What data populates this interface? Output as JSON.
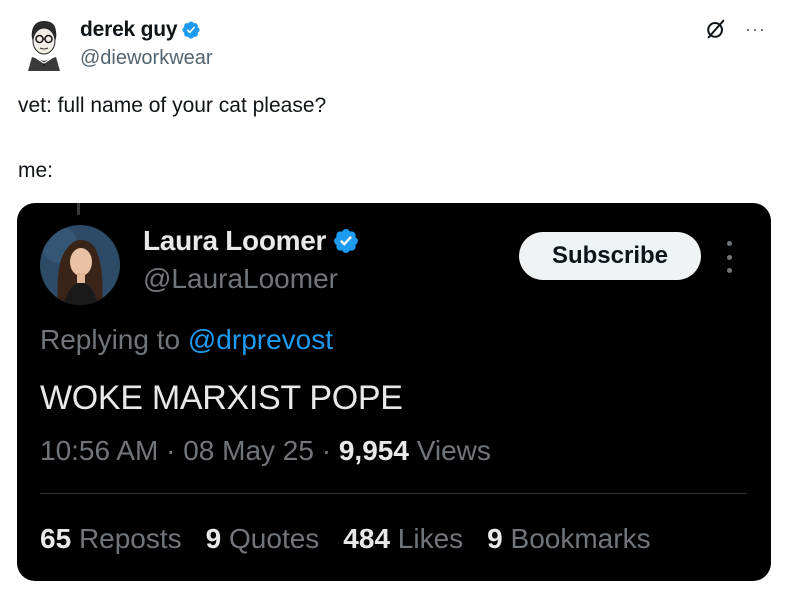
{
  "outer_tweet": {
    "display_name": "derek guy",
    "handle": "@dieworkwear",
    "text_line1": "vet: full name of your cat please?",
    "text_line2": "me:",
    "more_label": "···"
  },
  "embedded_tweet": {
    "display_name": "Laura Loomer",
    "handle": "@LauraLoomer",
    "subscribe_label": "Subscribe",
    "replying_prefix": "Replying to",
    "replying_handle": "@drprevost",
    "text": "WOKE MARXIST POPE",
    "time": "10:56 AM",
    "date": "08 May 25",
    "views_count": "9,954",
    "views_label": "Views",
    "stats": [
      {
        "count": "65",
        "label": "Reposts"
      },
      {
        "count": "9",
        "label": "Quotes"
      },
      {
        "count": "484",
        "label": "Likes"
      },
      {
        "count": "9",
        "label": "Bookmarks"
      }
    ]
  },
  "colors": {
    "verified_blue": "#1d9bf0",
    "link_blue": "#1d9bf0",
    "dark_bg": "#000000",
    "muted_text": "#71767b"
  },
  "icons": {
    "verified": "verified-badge-icon",
    "grok": "grok-icon",
    "more": "more-dots-icon"
  }
}
